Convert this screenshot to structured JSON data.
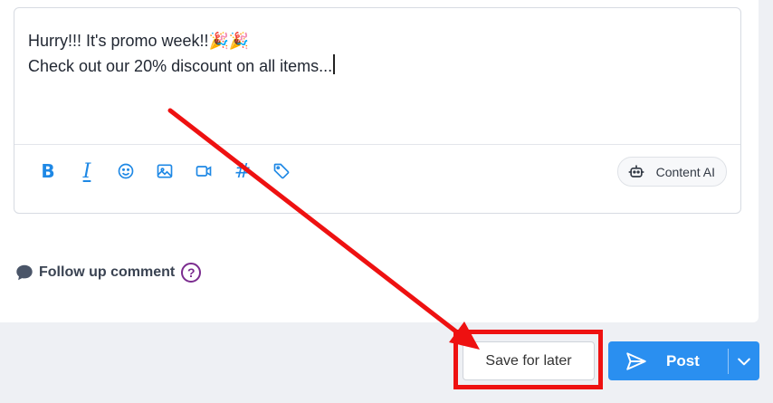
{
  "editor": {
    "line1": "Hurry!!! It's promo week!!🎉🎉",
    "line2": "Check out our 20% discount on all items..."
  },
  "toolbar": {
    "tools": [
      "bold-icon",
      "italic-icon",
      "emoji-icon",
      "image-icon",
      "video-icon",
      "hashtag-icon",
      "tag-icon"
    ],
    "ai_label": "Content AI"
  },
  "followup": {
    "label": "Follow up comment",
    "help": "?"
  },
  "actions": {
    "save_label": "Save for later",
    "post_label": "Post"
  },
  "colors": {
    "accent": "#1e88e5",
    "post_bg": "#2a8ff0",
    "annotation": "#ee1111",
    "help": "#7b2c8f"
  }
}
